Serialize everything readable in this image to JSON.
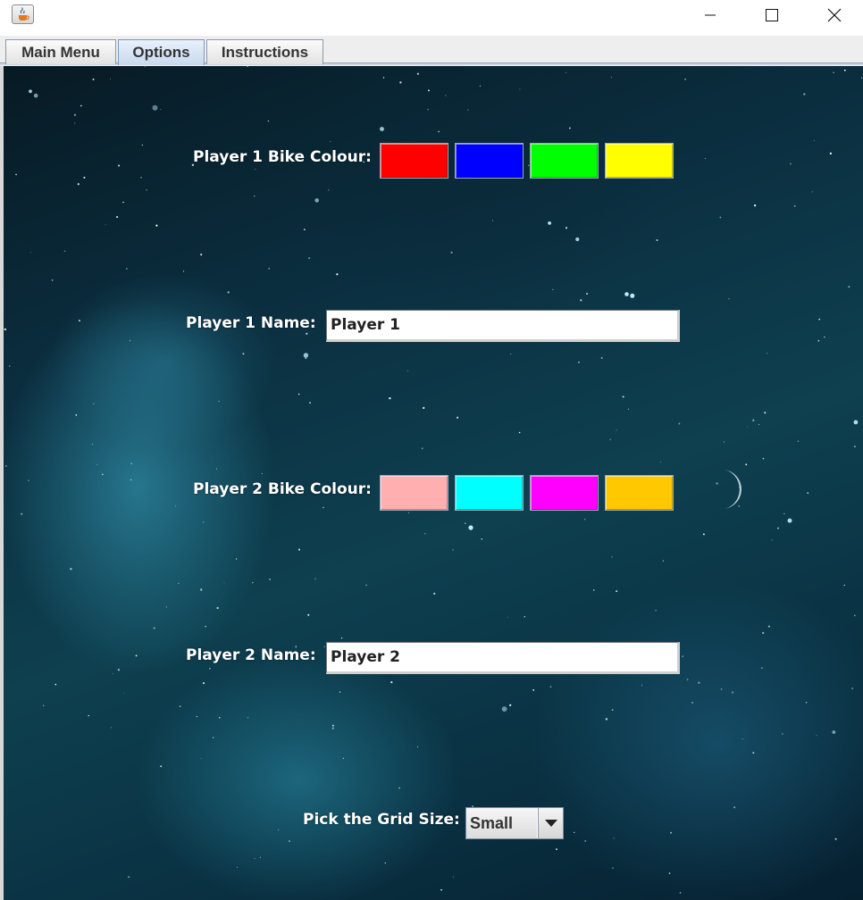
{
  "window": {
    "icon": "java-cup-icon",
    "controls": [
      "minimize-icon",
      "maximize-icon",
      "close-icon"
    ]
  },
  "tabs": [
    {
      "label": "Main Menu",
      "selected": false
    },
    {
      "label": "Options",
      "selected": true
    },
    {
      "label": "Instructions",
      "selected": false
    }
  ],
  "options": {
    "player1_colour_label": "Player 1 Bike Colour:",
    "player1_colours": [
      "#ff0000",
      "#0000ff",
      "#00ff00",
      "#ffff00"
    ],
    "player1_name_label": "Player 1 Name:",
    "player1_name_value": "Player 1",
    "player2_colour_label": "Player 2 Bike Colour:",
    "player2_colours": [
      "#ffafaf",
      "#00ffff",
      "#ff00ff",
      "#ffc800"
    ],
    "player2_name_label": "Player 2 Name:",
    "player2_name_value": "Player 2",
    "grid_size_label": "Pick the Grid Size:",
    "grid_size_value": "Small"
  }
}
